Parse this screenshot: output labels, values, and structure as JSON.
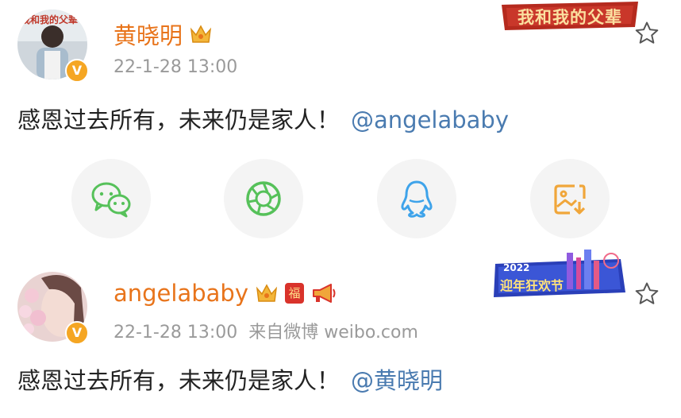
{
  "posts": [
    {
      "author": "黄晓明",
      "timestamp": "22-1-28 13:00",
      "source": "",
      "text": "感恩过去所有，未来仍是家人！",
      "mention": "@angelababy",
      "avatar_caption": "我和我的父辈",
      "banner_text": "我和我的父辈",
      "verified_mark": "V",
      "icons": [
        "crown-icon"
      ]
    },
    {
      "author": "angelababy",
      "timestamp": "22-1-28 13:00",
      "source": "来自微博 weibo.com",
      "text": "感恩过去所有，未来仍是家人！",
      "mention": "@黄晓明",
      "banner_year": "2022",
      "banner_text": "迎年狂欢节",
      "verified_mark": "V",
      "fu_badge": "福",
      "icons": [
        "crown-icon",
        "fu-badge-icon",
        "megaphone-icon"
      ]
    }
  ],
  "share_buttons": [
    "wechat-icon",
    "moments-icon",
    "qq-icon",
    "save-image-icon"
  ],
  "colors": {
    "name": "#e8741b",
    "mention": "#4a7bb0",
    "meta": "#9a9a9a",
    "wechat": "#56c15a",
    "moments": "#56c15a",
    "qq": "#3ea3ea",
    "save": "#f0a63a",
    "verified": "#f5a623"
  }
}
